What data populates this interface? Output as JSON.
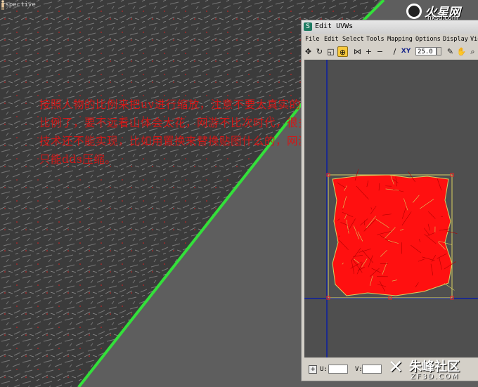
{
  "viewport": {
    "label": "rspective",
    "annotation": "按照人物的比例来把uv进行缩放，注意不要太真实的比例了，要不远看山体会太花，网游不比次时代，很多技术还不能实现，比如用置换来替换贴图什么的，网游只能dds压缩。",
    "colors": {
      "rock": "#3b3b3b",
      "ground": "#5e5e5e",
      "edge": "#33e03a",
      "annotation": "#d21818"
    }
  },
  "watermark_top": {
    "name": "火星网",
    "url": "hxsd.com"
  },
  "uv_window": {
    "title": "Edit UVWs",
    "menu": [
      "File",
      "Edit",
      "Select",
      "Tools",
      "Mapping",
      "Options",
      "Display",
      "Vie"
    ],
    "toolbar": {
      "icons": [
        "move-icon",
        "rotate-icon",
        "scale-icon",
        "freeform-icon",
        "mirror-icon",
        "expand-icon",
        "contract-icon",
        "paint-icon",
        "xy-icon",
        "map-icon",
        "pan-icon",
        "zoom-icon"
      ],
      "uv_axis": "XY",
      "zoom_value": "25.0"
    },
    "status": {
      "u_label": "U:",
      "v_label": "V:"
    },
    "colors": {
      "background": "#4f4f4f",
      "axis": "#1c2a8c",
      "mesh_fill": "#ff1010",
      "mesh_edge": "#d8d060"
    }
  },
  "watermark_bottom": {
    "name": "朱峰社区",
    "url": "ZF3D.COM"
  }
}
